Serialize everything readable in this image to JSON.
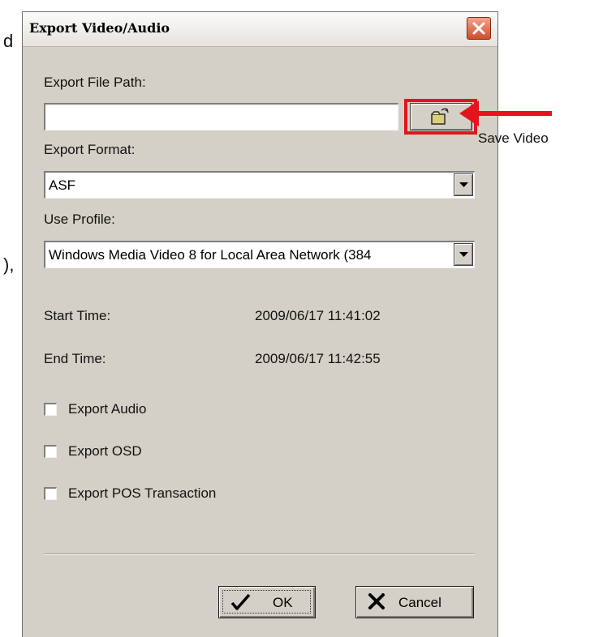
{
  "background": {
    "left_chars": [
      "d",
      "),"
    ]
  },
  "dialog": {
    "title": "Export Video/Audio",
    "close_icon": "close-x-icon",
    "export_path_label": "Export File Path:",
    "export_path_value": "",
    "browse_icon": "open-folder-icon",
    "format_label": "Export Format:",
    "format_value": "ASF",
    "profile_label": "Use Profile:",
    "profile_value": "Windows Media Video 8 for Local Area Network (384",
    "start_time_label": "Start Time:",
    "start_time_value": "2009/06/17 11:41:02",
    "end_time_label": "End Time:",
    "end_time_value": "2009/06/17 11:42:55",
    "checkboxes": [
      {
        "label": "Export Audio",
        "checked": false
      },
      {
        "label": "Export OSD",
        "checked": false
      },
      {
        "label": "Export POS Transaction",
        "checked": false
      }
    ],
    "ok_label": "OK",
    "ok_icon": "checkmark-icon",
    "cancel_label": "Cancel",
    "cancel_icon": "x-mark-icon"
  },
  "annotation": {
    "text": "Save Video",
    "color": "#e3141c"
  }
}
